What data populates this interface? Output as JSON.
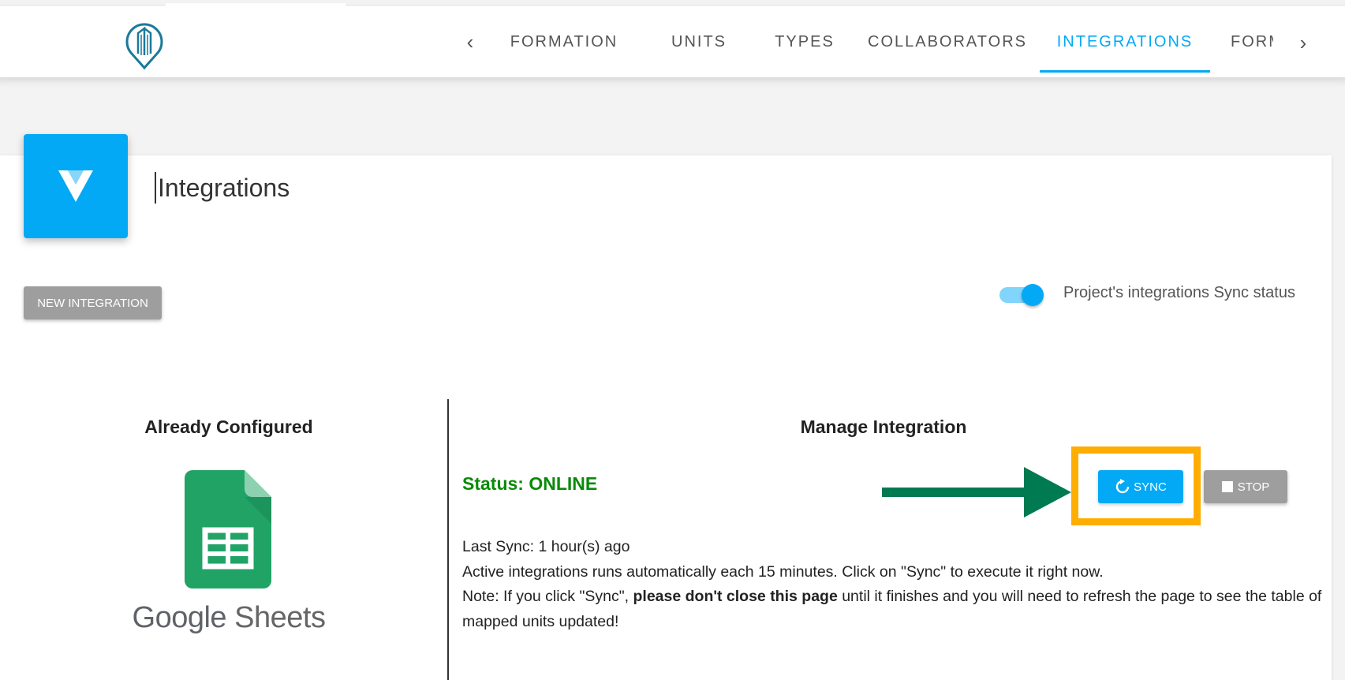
{
  "nav": {
    "prev_icon": "chevron-left-icon",
    "next_icon": "chevron-right-icon",
    "tabs": [
      {
        "label": "FORMATION",
        "active": false
      },
      {
        "label": "UNITS",
        "active": false
      },
      {
        "label": "TYPES",
        "active": false
      },
      {
        "label": "COLLABORATORS",
        "active": false
      },
      {
        "label": "INTEGRATIONS",
        "active": true
      },
      {
        "label": "FORM",
        "active": false
      }
    ]
  },
  "page": {
    "title": "Integrations",
    "icon": "v-logo-icon",
    "new_integration_label": "NEW INTEGRATION",
    "sync_toggle_label": "Project's integrations Sync status",
    "sync_toggle_on": true
  },
  "left": {
    "heading": "Already Configured",
    "product_name": "Google Sheets",
    "product_name_first": "Google",
    "product_name_second": "Sheets"
  },
  "right": {
    "heading": "Manage Integration",
    "status": "Status: ONLINE",
    "sync_label": "SYNC",
    "stop_label": "STOP",
    "last_sync": "Last Sync: 1 hour(s) ago",
    "auto_run_note": "Active integrations runs automatically each 15 minutes. Click on \"Sync\" to execute it right now.",
    "note_prefix": "Note: If you click \"Sync\", ",
    "note_bold": "please don't close this page",
    "note_suffix": " until it finishes and you will need to refresh the page to see the table of mapped units updated!"
  },
  "colors": {
    "accent": "#03a9f4",
    "status_online": "#0a8a0a",
    "highlight": "#ffad00",
    "arrow": "#007a50"
  }
}
